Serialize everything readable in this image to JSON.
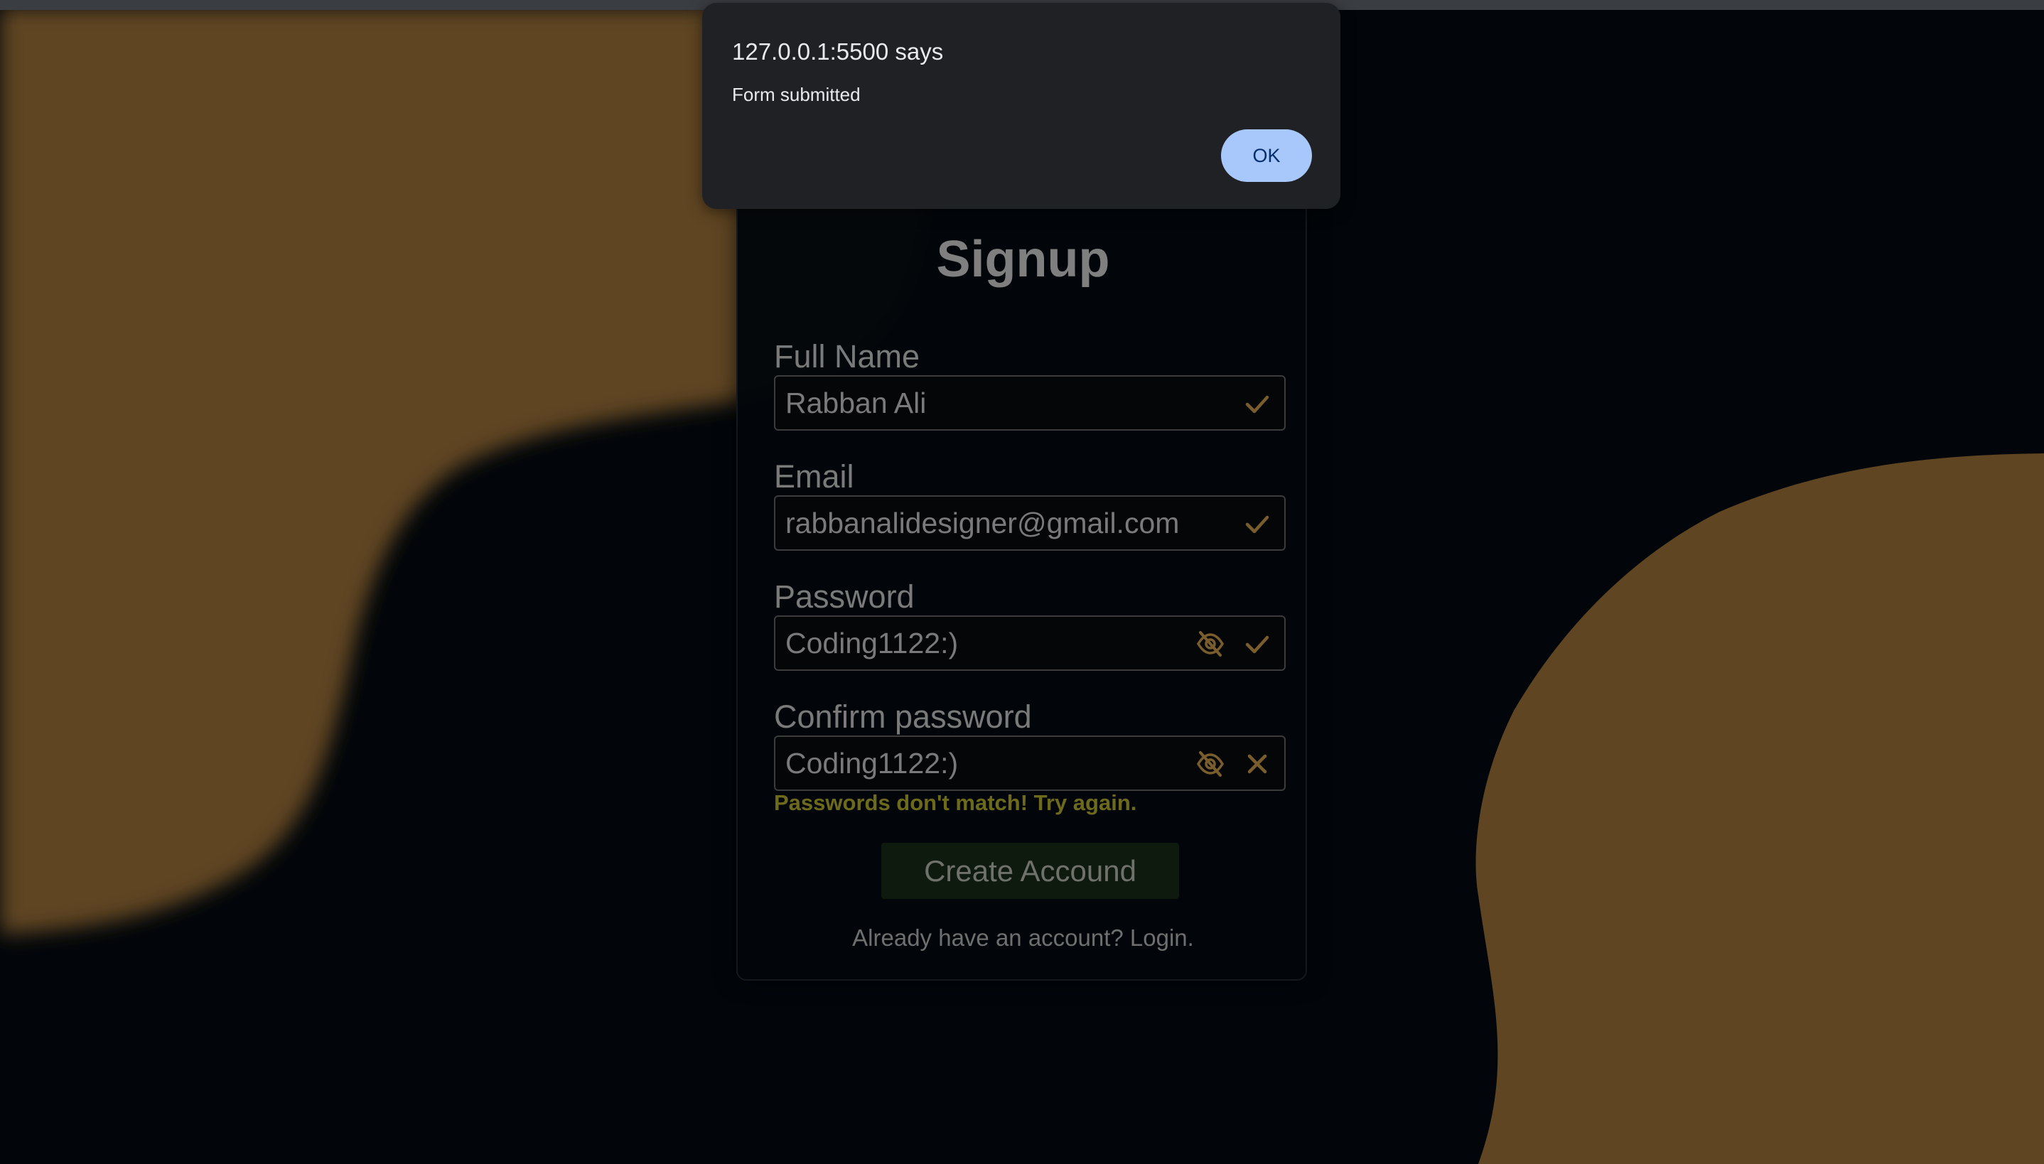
{
  "dialog": {
    "title": "127.0.0.1:5500 says",
    "message": "Form submitted",
    "ok_label": "OK"
  },
  "form": {
    "title": "Signup",
    "fields": [
      {
        "label": "Full Name",
        "value": "Rabban Ali",
        "status": "valid"
      },
      {
        "label": "Email",
        "value": "rabbanalidesigner@gmail.com",
        "status": "valid"
      },
      {
        "label": "Password",
        "value": "Coding1122:)",
        "status": "valid",
        "toggle_icon": "eye-slash-icon"
      },
      {
        "label": "Confirm password",
        "value": "Coding1122:)",
        "status": "invalid",
        "toggle_icon": "eye-slash-icon"
      }
    ],
    "error_message": "Passwords don't match! Try again.",
    "submit_label": "Create Accound",
    "login_prompt": "Already have an account? Login."
  },
  "colors": {
    "background": "#02060a",
    "blob": "#5f4522",
    "accent_icon": "#7a5d2c",
    "error_text": "#6e6a1c",
    "dialog_bg": "#202124",
    "ok_button": "#a8c7fa"
  }
}
